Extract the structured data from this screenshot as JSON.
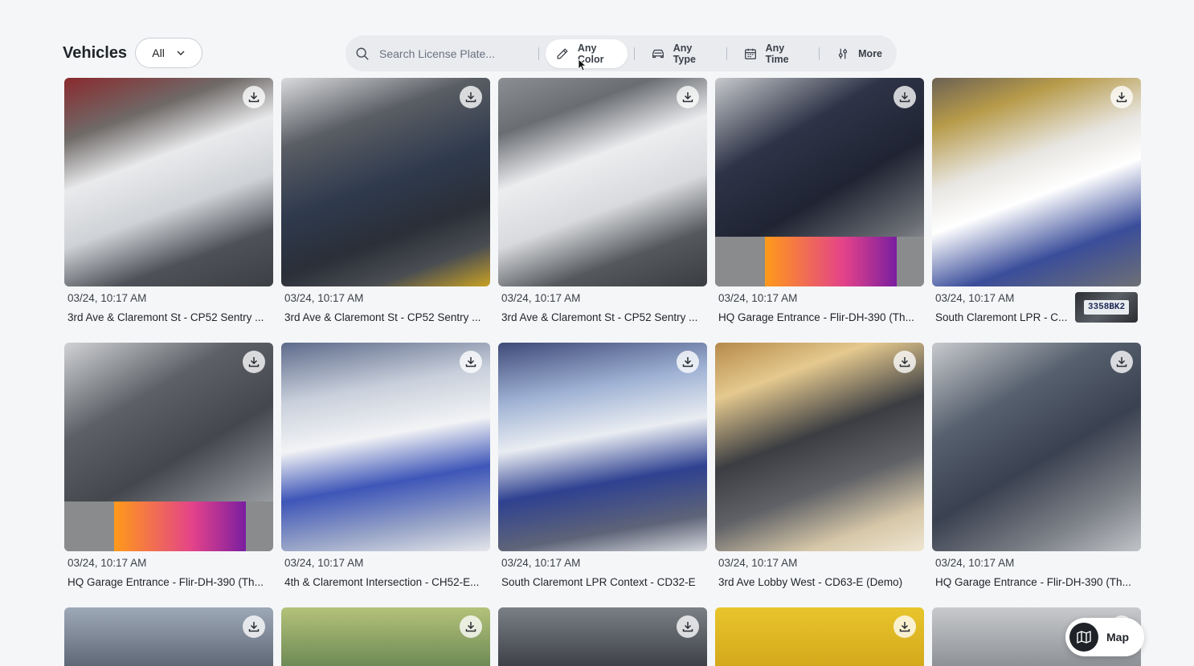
{
  "header": {
    "title": "Vehicles",
    "scope_selected": "All"
  },
  "filters": {
    "search_placeholder": "Search License Plate...",
    "color_label": "Any Color",
    "type_label": "Any Type",
    "time_label": "Any Time",
    "more_label": "More"
  },
  "cards": [
    {
      "timestamp": "03/24, 10:17 AM",
      "camera": "3rd Ave & Claremont St - CP52 Sentry ...",
      "bg": "linear-gradient(160deg,#8a2a2e 0%,#6f6a68 22%,#e9eaec 40%,#cfd2d6 60%,#4e5258 80%,#3c3f44 100%)"
    },
    {
      "timestamp": "03/24, 10:17 AM",
      "camera": "3rd Ave & Claremont St - CP52 Sentry ...",
      "bg": "linear-gradient(160deg,#d9dadc 0%,#5a5e64 25%,#2f3a4d 50%,#2a2f38 70%,#4a4d52 85%,#c9a224 100%)"
    },
    {
      "timestamp": "03/24, 10:17 AM",
      "camera": "3rd Ave & Claremont St - CP52 Sentry ...",
      "bg": "linear-gradient(160deg,#8b8e93 0%,#6a6d72 20%,#ecedef 40%,#d8dadd 60%,#55585d 80%,#3a3d42 100%)"
    },
    {
      "timestamp": "03/24, 10:17 AM",
      "camera": "HQ Garage Entrance - Flir-DH-390 (Th...",
      "bg": "linear-gradient(150deg,#c7c9cc 0%,#2e3447 30%,#1f2433 55%,#6b6e74 80%,#bfc2c6 100%)",
      "thermal": true
    },
    {
      "timestamp": "03/24, 10:17 AM",
      "camera": "South Claremont LPR - C...",
      "bg": "linear-gradient(160deg,#6c6154 0%,#b79b4a 18%,#e8e6e2 40%,#ffffff 55%,#3a4d9a 78%,#6e7074 100%)",
      "plate": "3358BK2"
    },
    {
      "timestamp": "03/24, 10:17 AM",
      "camera": "HQ Garage Entrance - Flir-DH-390 (Th...",
      "bg": "linear-gradient(150deg,#d0d2d5 0%,#5d6066 30%,#44474d 55%,#8b8e93 80%,#c4c6c9 100%)",
      "thermal": true
    },
    {
      "timestamp": "03/24, 10:17 AM",
      "camera": "4th & Claremont Intersection - CH52-E...",
      "bg": "linear-gradient(170deg,#5d6a8a 0%,#c9d0dc 25%,#f2f3f5 45%,#3e56b8 65%,#9aa6c8 85%,#e4e6ea 100%)"
    },
    {
      "timestamp": "03/24, 10:17 AM",
      "camera": "South Claremont LPR Context - CD32-E",
      "bg": "linear-gradient(170deg,#3e4a78 0%,#9fb2d4 25%,#e9edf2 45%,#2f4191 65%,#5e6478 85%,#d4d7dc 100%)"
    },
    {
      "timestamp": "03/24, 10:17 AM",
      "camera": "3rd Ave Lobby West - CD63-E (Demo)",
      "bg": "linear-gradient(160deg,#b58a4a 0%,#e5c98e 20%,#3b3d42 45%,#5f6166 65%,#d6c7a8 85%,#efe6d2 100%)"
    },
    {
      "timestamp": "03/24, 10:17 AM",
      "camera": "HQ Garage Entrance - Flir-DH-390 (Th...",
      "bg": "linear-gradient(150deg,#c8cacd 0%,#56606e 30%,#3a4150 55%,#7d8188 80%,#c0c3c7 100%)"
    },
    {
      "bg": "linear-gradient(180deg,#9ea9b8 0%,#5f6876 100%)"
    },
    {
      "bg": "linear-gradient(180deg,#b4c27a 0%,#6e8a55 100%)"
    },
    {
      "bg": "linear-gradient(180deg,#7b7f86 0%,#3e4148 100%)"
    },
    {
      "bg": "linear-gradient(180deg,#e8c52c 0%,#d4a91c 100%)"
    },
    {
      "bg": "linear-gradient(180deg,#c7c9cc 0%,#8e9196 100%)"
    }
  ],
  "map": {
    "label": "Map"
  }
}
